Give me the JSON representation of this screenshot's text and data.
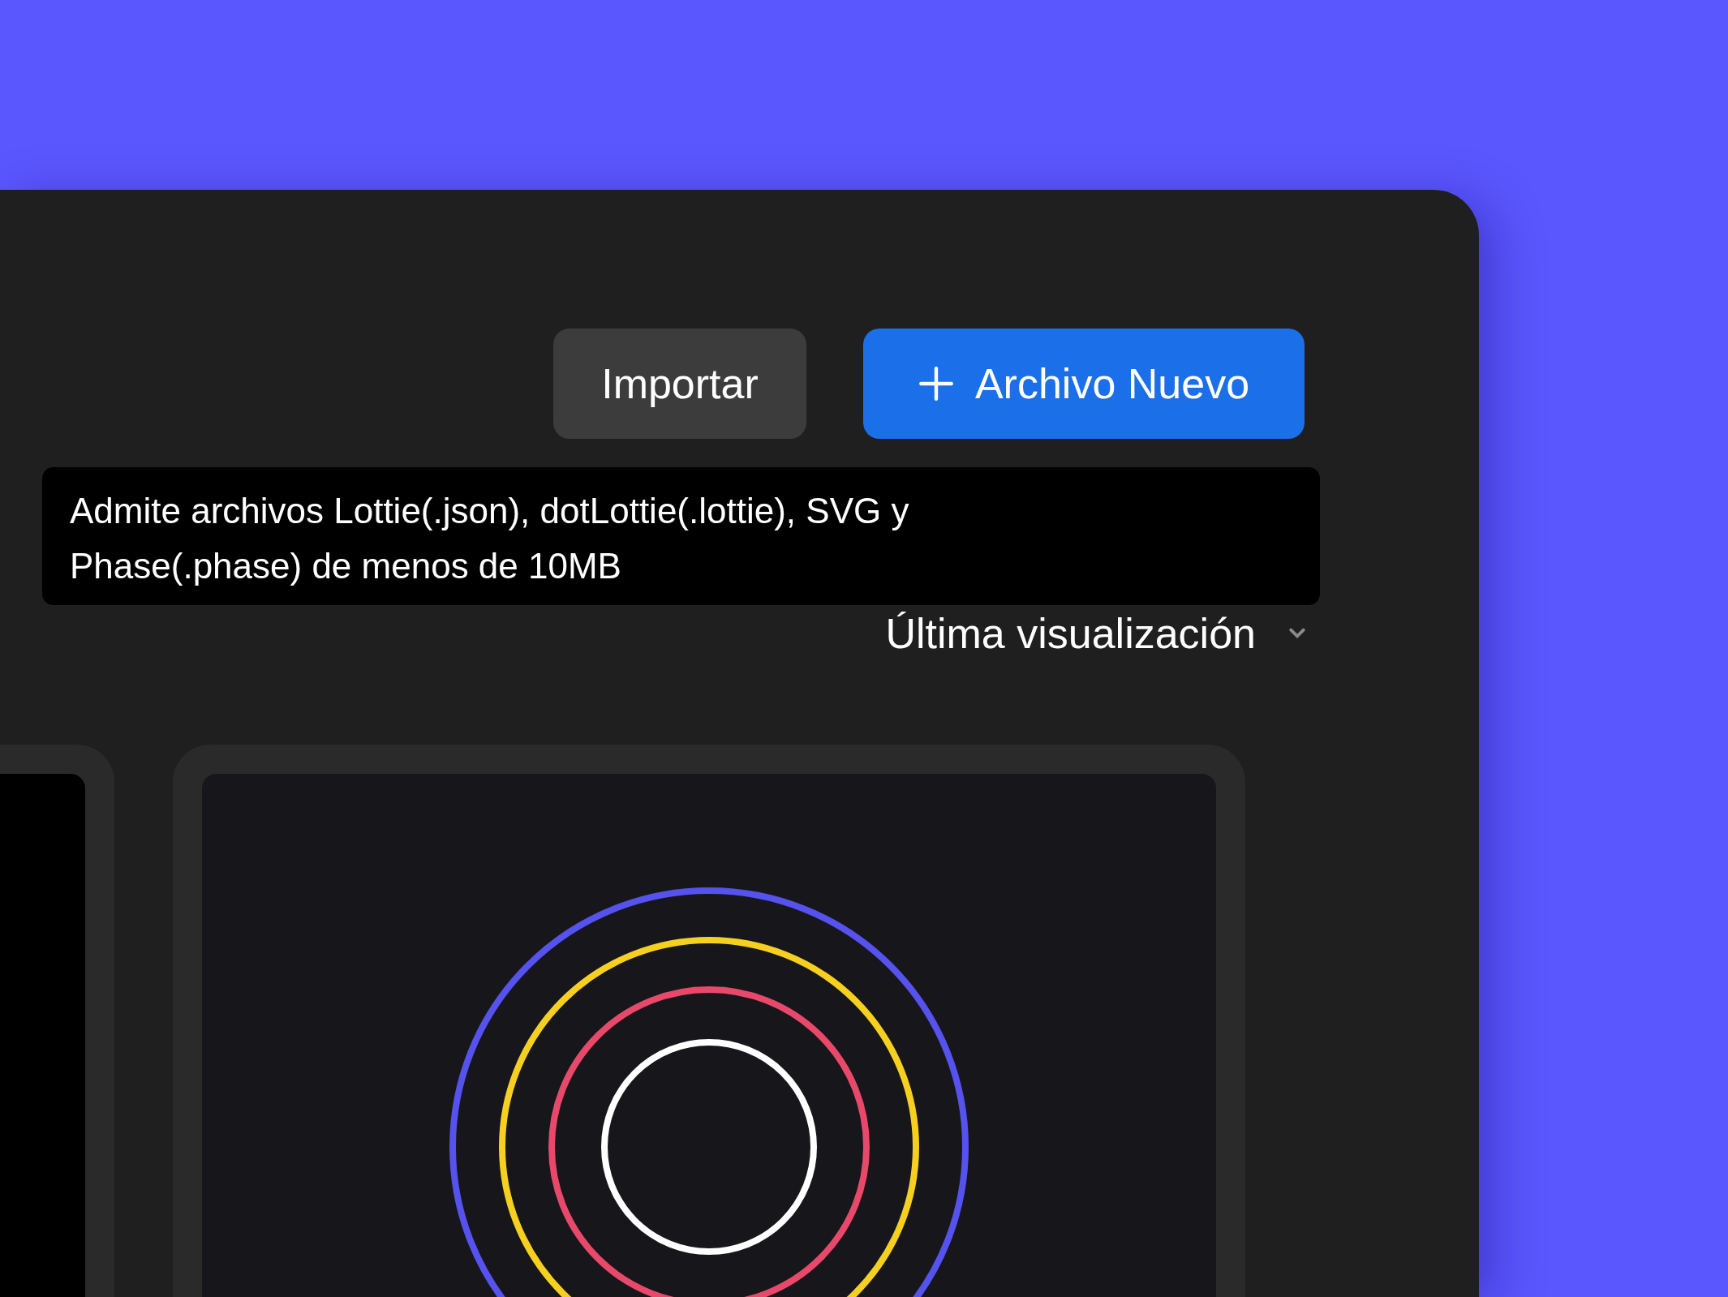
{
  "buttons": [
    {
      "label": "Importar",
      "kind": "secondary"
    },
    {
      "label": "Archivo Nuevo",
      "kind": "primary"
    }
  ],
  "tooltip": {
    "text": "Admite archivos Lottie(.json), dotLottie(.lottie), SVG y Phase(.phase) de menos de 10MB"
  },
  "sort": {
    "label": "Última visualización"
  }
}
